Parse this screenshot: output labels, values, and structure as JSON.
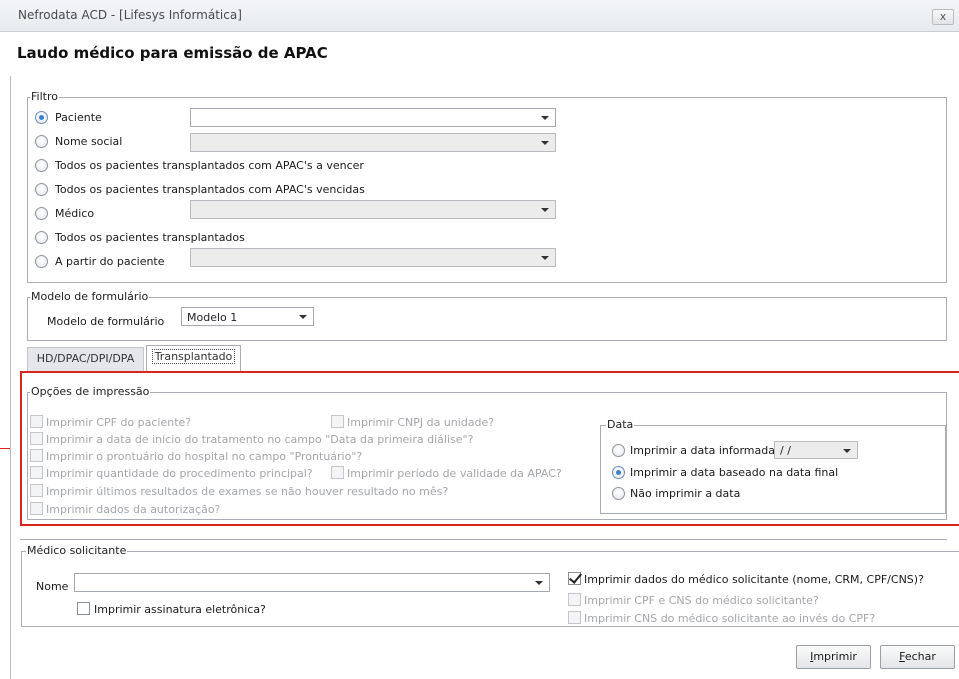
{
  "window": {
    "title": "Nefrodata ACD - [Lifesys Informática]",
    "close_glyph": "x"
  },
  "page_title": "Laudo médico para emissão de APAC",
  "filtro": {
    "label": "Filtro",
    "options": [
      {
        "label": "Paciente",
        "selected": true
      },
      {
        "label": "Nome social",
        "selected": false
      },
      {
        "label": "Todos os pacientes transplantados com APAC's a vencer",
        "selected": false
      },
      {
        "label": "Todos os pacientes transplantados com APAC's vencidas",
        "selected": false
      },
      {
        "label": "Médico",
        "selected": false
      },
      {
        "label": "Todos os pacientes transplantados",
        "selected": false
      },
      {
        "label": "A partir do paciente",
        "selected": false
      }
    ]
  },
  "modelo": {
    "group_label": "Modelo de formulário",
    "field_label": "Modelo de formulário",
    "value": "Modelo 1"
  },
  "tabs": [
    {
      "label": "HD/DPAC/DPI/DPA",
      "active": false
    },
    {
      "label": "Transplantado",
      "active": true
    }
  ],
  "opcoes": {
    "label": "Opções de impressão",
    "checkboxes": [
      "Imprimir CPF do paciente?",
      "Imprimir CNPJ da unidade?",
      "Imprimir a data de início do tratamento no campo \"Data da primeira diálise\"?",
      "Imprimir o prontuário do hospital no campo \"Prontuário\"?",
      "Imprimir quantidade do procedimento principal?",
      "Imprimir período de validade da APAC?",
      "Imprimir últimos resultados de exames se não houver resultado no mês?",
      "Imprimir dados da autorização?"
    ],
    "data": {
      "label": "Data",
      "options": [
        {
          "label": "Imprimir a data informada",
          "selected": false
        },
        {
          "label": "Imprimir a data baseado na data final",
          "selected": true
        },
        {
          "label": "Não imprimir a data",
          "selected": false
        }
      ],
      "date_placeholder": " / /"
    }
  },
  "medico": {
    "label": "Médico solicitante",
    "nome_label": "Nome",
    "assinatura": "Imprimir assinatura eletrônica?",
    "dados": "Imprimir dados do médico solicitante (nome, CRM, CPF/CNS)?",
    "cpf_cns": "Imprimir CPF e CNS do médico solicitante?",
    "cns_cpf": "Imprimir CNS do médico solicitante ao invés do CPF?"
  },
  "buttons": {
    "imprimir": {
      "accel": "I",
      "rest": "mprimir"
    },
    "fechar": {
      "accel": "F",
      "rest": "echar"
    }
  },
  "colors": {
    "accent": "#3c7fd1",
    "highlight_frame": "#d9261c"
  }
}
